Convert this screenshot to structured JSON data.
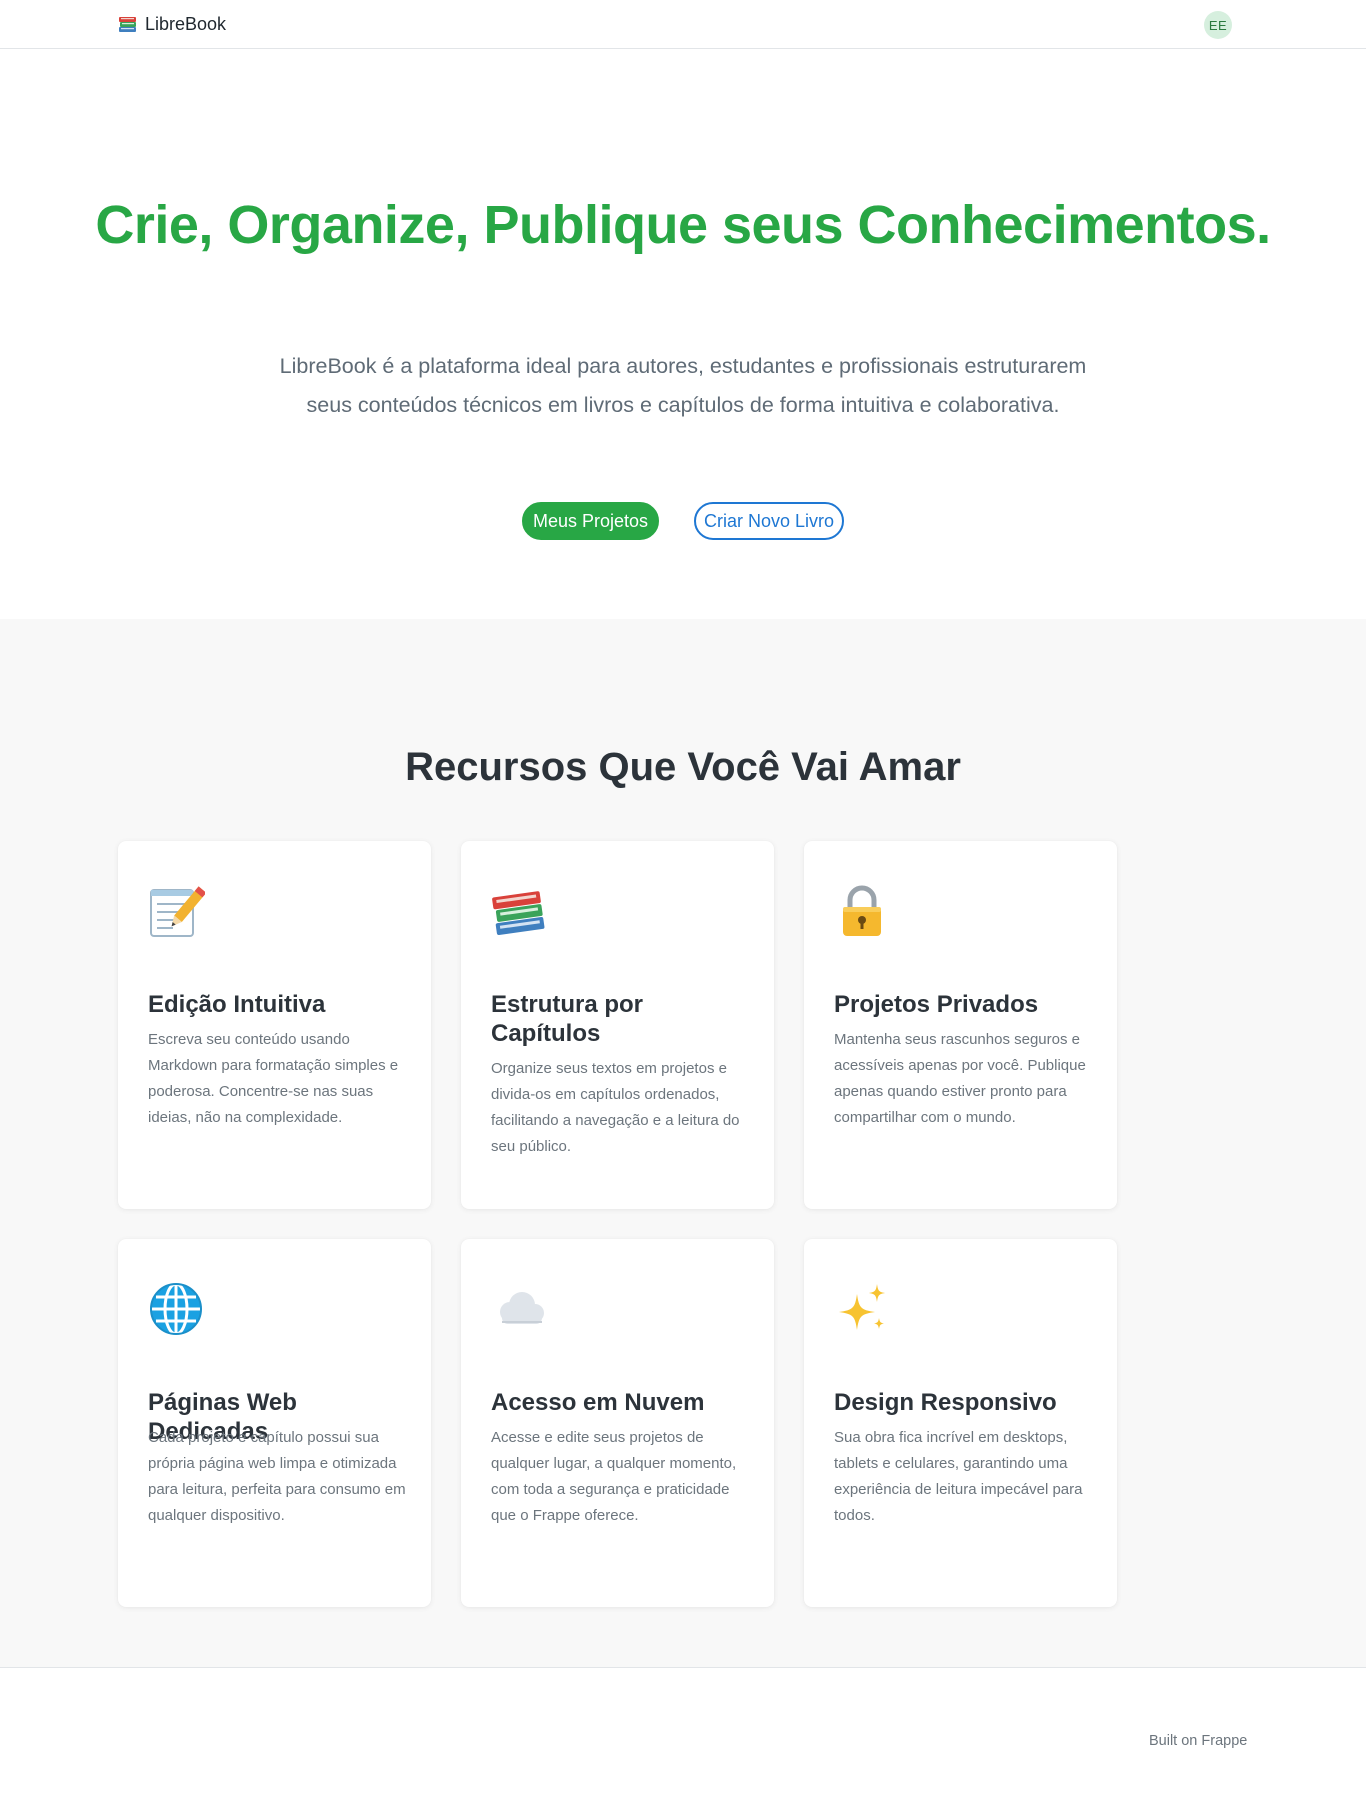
{
  "nav": {
    "brand": "LibreBook",
    "brand_icon": "books-icon",
    "avatar_initials": "EE"
  },
  "hero": {
    "title": "Crie, Organize, Publique seus Conhecimentos.",
    "subtitle": "LibreBook é a plataforma ideal para autores, estudantes e profissionais estruturarem seus conteúdos técnicos em livros e capítulos de forma intuitiva e colaborativa.",
    "primary_button": "Meus Projetos",
    "secondary_button": "Criar Novo Livro"
  },
  "features": {
    "title": "Recursos Que Você Vai Amar",
    "cards": [
      {
        "icon": "memo-pencil-icon",
        "title": "Edição Intuitiva",
        "description": "Escreva seu conteúdo usando Markdown para formatação simples e poderosa. Concentre-se nas suas ideias, não na complexidade."
      },
      {
        "icon": "books-icon",
        "title": "Estrutura por Capítulos",
        "description": "Organize seus textos em projetos e divida-os em capítulos ordenados, facilitando a navegação e a leitura do seu público."
      },
      {
        "icon": "lock-icon",
        "title": "Projetos Privados",
        "description": "Mantenha seus rascunhos seguros e acessíveis apenas por você. Publique apenas quando estiver pronto para compartilhar com o mundo."
      },
      {
        "icon": "globe-icon",
        "title": "Páginas Web Dedicadas",
        "description": "Cada projeto e capítulo possui sua própria página web limpa e otimizada para leitura, perfeita para consumo em qualquer dispositivo."
      },
      {
        "icon": "cloud-icon",
        "title": "Acesso em Nuvem",
        "description": "Acesse e edite seus projetos de qualquer lugar, a qualquer momento, com toda a segurança e praticidade que o Frappe oferece."
      },
      {
        "icon": "sparkles-icon",
        "title": "Design Responsivo",
        "description": "Sua obra fica incrível em desktops, tablets e celulares, garantindo uma experiência de leitura impecável para todos."
      }
    ]
  },
  "footer": {
    "text": "Built on Frappe"
  },
  "colors": {
    "accent_green": "#28a745",
    "accent_blue": "#1e77d3",
    "section_bg": "#f8f8f8"
  }
}
